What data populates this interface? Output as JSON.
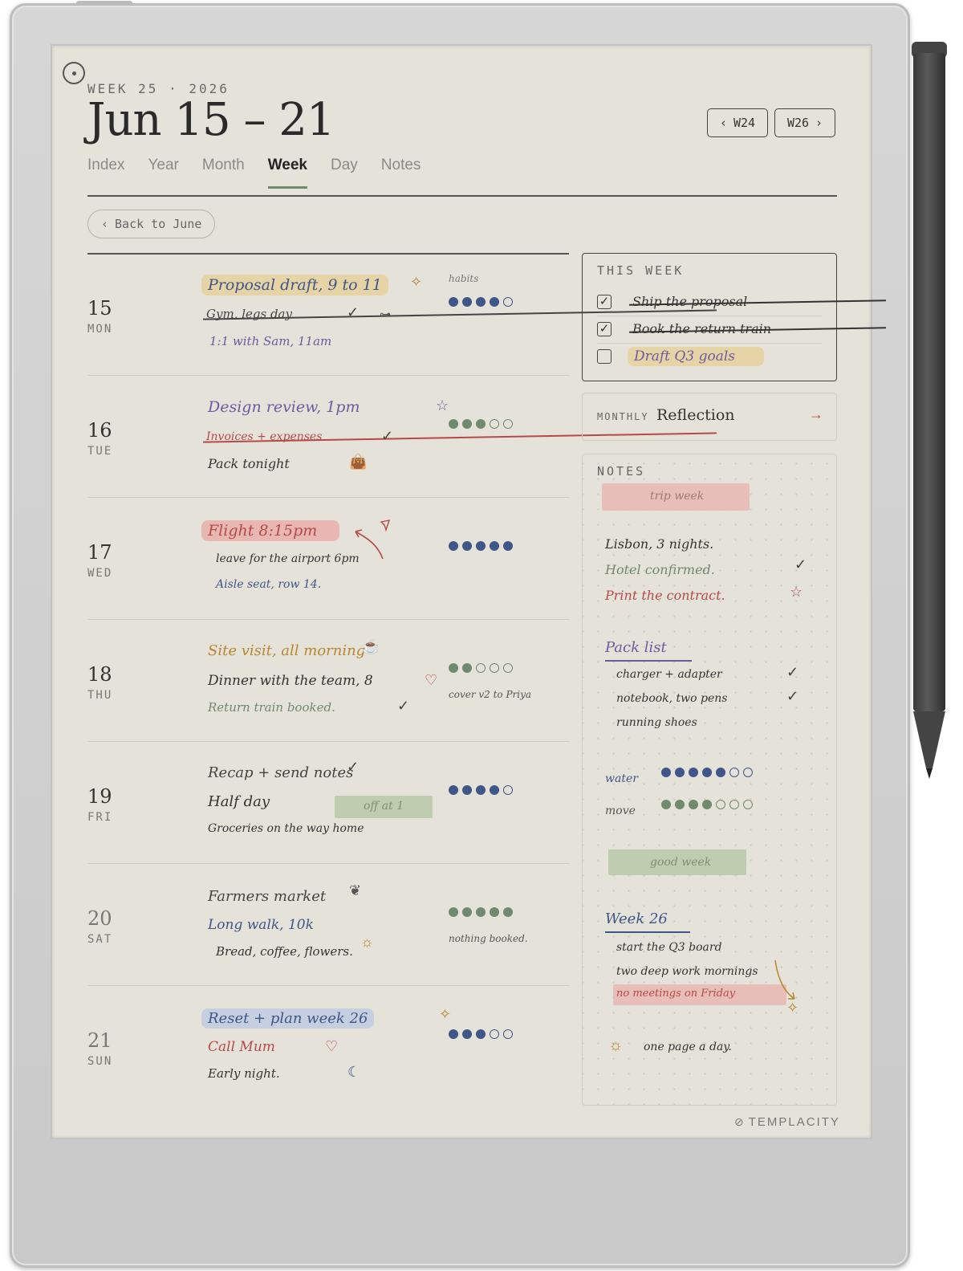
{
  "header": {
    "week_label": "WEEK 25 · 2026",
    "title": "Jun 15 – 21",
    "prev_week": "W24",
    "next_week": "W26",
    "back_label": "Back to June"
  },
  "tabs": [
    {
      "label": "Index"
    },
    {
      "label": "Year"
    },
    {
      "label": "Month"
    },
    {
      "label": "Week",
      "active": true
    },
    {
      "label": "Day"
    },
    {
      "label": "Notes"
    }
  ],
  "days": [
    {
      "num": "15",
      "dow": "MON",
      "lines": [
        "Proposal draft, 9 to 11",
        "Gym, legs day",
        "1:1 with Sam, 11am"
      ],
      "habits_label": "habits",
      "habits": {
        "filled": 4,
        "total": 5
      }
    },
    {
      "num": "16",
      "dow": "TUE",
      "lines": [
        "Design review, 1pm",
        "Invoices + expenses",
        "Pack tonight"
      ],
      "habits": {
        "filled": 3,
        "total": 5
      }
    },
    {
      "num": "17",
      "dow": "WED",
      "lines": [
        "Flight 8:15pm",
        "leave for the airport 6pm",
        "Aisle seat, row 14."
      ],
      "habits": {
        "filled": 5,
        "total": 5
      }
    },
    {
      "num": "18",
      "dow": "THU",
      "lines": [
        "Site visit, all morning",
        "Dinner with the team, 8",
        "Return train booked."
      ],
      "habits": {
        "filled": 2,
        "total": 5
      },
      "side_note": "cover v2 to Priya"
    },
    {
      "num": "19",
      "dow": "FRI",
      "lines": [
        "Recap + send notes",
        "Half day",
        "Groceries on the way home"
      ],
      "tag": "off at 1",
      "habits": {
        "filled": 4,
        "total": 5
      }
    },
    {
      "num": "20",
      "dow": "SAT",
      "lines": [
        "Farmers market",
        "Long walk, 10k",
        "Bread, coffee, flowers."
      ],
      "habits": {
        "filled": 5,
        "total": 5
      },
      "side_note": "nothing booked."
    },
    {
      "num": "21",
      "dow": "SUN",
      "lines": [
        "Reset + plan week 26",
        "Call Mum",
        "Early night."
      ],
      "habits": {
        "filled": 3,
        "total": 5
      }
    }
  ],
  "this_week": {
    "label": "THIS WEEK",
    "items": [
      {
        "text": "Ship the proposal",
        "done": true
      },
      {
        "text": "Book the return train",
        "done": true
      },
      {
        "text": "Draft Q3 goals",
        "done": false
      }
    ]
  },
  "reflection": {
    "prefix": "MONTHLY",
    "title": "Reflection"
  },
  "notes": {
    "label": "NOTES",
    "trip_tag": "trip week",
    "trip_lines": [
      "Lisbon, 3 nights.",
      "Hotel confirmed.",
      "Print the contract."
    ],
    "pack_title": "Pack list",
    "pack_items": [
      "charger + adapter",
      "notebook, two pens",
      "running shoes"
    ],
    "trackers": [
      {
        "label": "water",
        "filled": 5,
        "total": 7
      },
      {
        "label": "move",
        "filled": 4,
        "total": 7
      }
    ],
    "good_tag": "good week",
    "next_title": "Week 26",
    "next_items": [
      "start the Q3 board",
      "two deep work mornings",
      "no meetings on Friday"
    ],
    "footer": "one page a day."
  },
  "brand": "TEMPLACITY",
  "colors": {
    "navy": "#3f5688",
    "sage": "#6f8a6c",
    "red": "#b64a48",
    "amber": "#b8862f",
    "purple": "#6f5aa0",
    "highlight_amber": "#e6d3a6",
    "highlight_pink": "#e8b7b2",
    "highlight_blue": "#c6cfdf",
    "highlight_green": "#b7c8a8"
  }
}
